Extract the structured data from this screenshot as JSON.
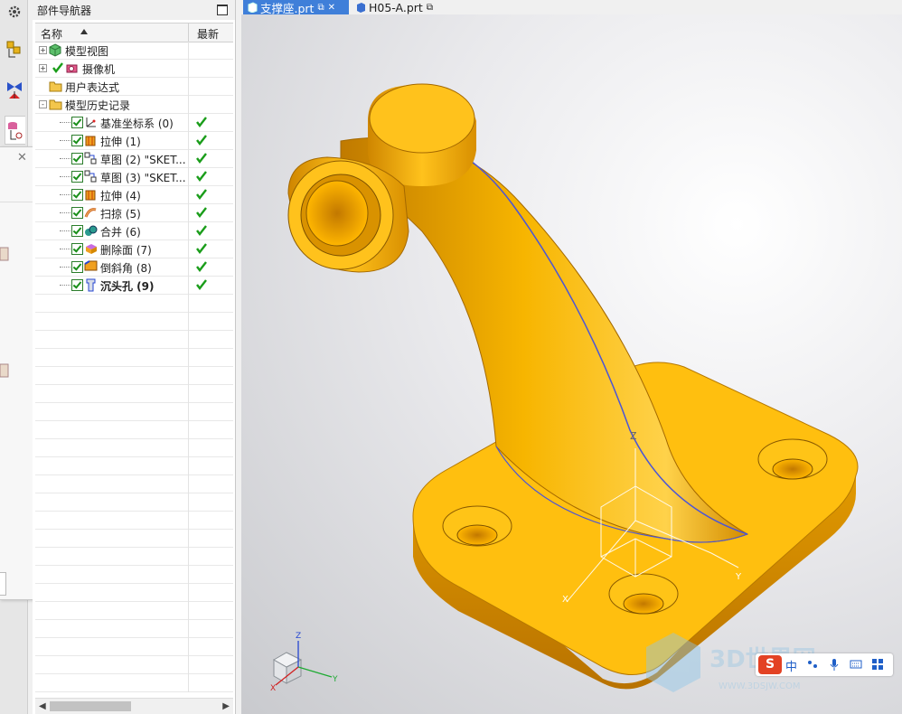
{
  "navigator": {
    "title": "部件导航器",
    "columns": {
      "name": "名称",
      "latest": "最新"
    },
    "rows": [
      {
        "label": "模型视图",
        "indent": 0,
        "expander": "+",
        "checked": false,
        "icon": "model-view-icon",
        "latest": false,
        "bold": false
      },
      {
        "label": "摄像机",
        "indent": 0,
        "expander": "+",
        "checked": "tick",
        "icon": "camera-icon",
        "latest": false,
        "bold": false
      },
      {
        "label": "用户表达式",
        "indent": 0,
        "expander": "",
        "checked": false,
        "icon": "folder-icon",
        "latest": false,
        "bold": false
      },
      {
        "label": "模型历史记录",
        "indent": 0,
        "expander": "-",
        "checked": false,
        "icon": "folder-icon",
        "latest": false,
        "bold": false
      },
      {
        "label": "基准坐标系 (0)",
        "indent": 1,
        "checked": true,
        "icon": "datum-csys-icon",
        "latest": true,
        "bold": false
      },
      {
        "label": "拉伸 (1)",
        "indent": 1,
        "checked": true,
        "icon": "extrude-icon",
        "latest": true,
        "bold": false
      },
      {
        "label": "草图 (2) \"SKET...",
        "indent": 1,
        "checked": true,
        "icon": "sketch-icon",
        "latest": true,
        "bold": false
      },
      {
        "label": "草图 (3) \"SKET...",
        "indent": 1,
        "checked": true,
        "icon": "sketch-icon",
        "latest": true,
        "bold": false
      },
      {
        "label": "拉伸 (4)",
        "indent": 1,
        "checked": true,
        "icon": "extrude-icon",
        "latest": true,
        "bold": false
      },
      {
        "label": "扫掠 (5)",
        "indent": 1,
        "checked": true,
        "icon": "sweep-icon",
        "latest": true,
        "bold": false
      },
      {
        "label": "合并 (6)",
        "indent": 1,
        "checked": true,
        "icon": "unite-icon",
        "latest": true,
        "bold": false
      },
      {
        "label": "删除面 (7)",
        "indent": 1,
        "checked": true,
        "icon": "delete-face-icon",
        "latest": true,
        "bold": false
      },
      {
        "label": "倒斜角 (8)",
        "indent": 1,
        "checked": true,
        "icon": "chamfer-icon",
        "latest": true,
        "bold": false
      },
      {
        "label": "沉头孔 (9)",
        "indent": 1,
        "checked": true,
        "icon": "counterbore-hole-icon",
        "latest": true,
        "bold": true
      }
    ]
  },
  "tabs": [
    {
      "label": "支撑座.prt",
      "active": true,
      "icons": [
        "part-icon",
        "pop-out-icon",
        "close-icon"
      ]
    },
    {
      "label": "H05-A.prt",
      "active": false,
      "icons": [
        "part-icon",
        "pop-out-icon"
      ]
    }
  ],
  "resource_bar": [
    "settings-icon",
    "assembly-navigator-icon",
    "constraint-navigator-icon",
    "part-navigator-icon"
  ],
  "triad": {
    "z": "Z",
    "y": "Y",
    "x": "X"
  },
  "watermark": "3D世界网 WWW.3DSJW.COM",
  "ime": {
    "logo": "S",
    "mode": "中",
    "icons": [
      "punctuation-icon",
      "microphone-icon",
      "keyboard-icon",
      "toolbox-icon"
    ]
  },
  "colors": {
    "model": "#f2a900",
    "tab_active": "#3f7fd9",
    "check": "#1a9d1a"
  }
}
